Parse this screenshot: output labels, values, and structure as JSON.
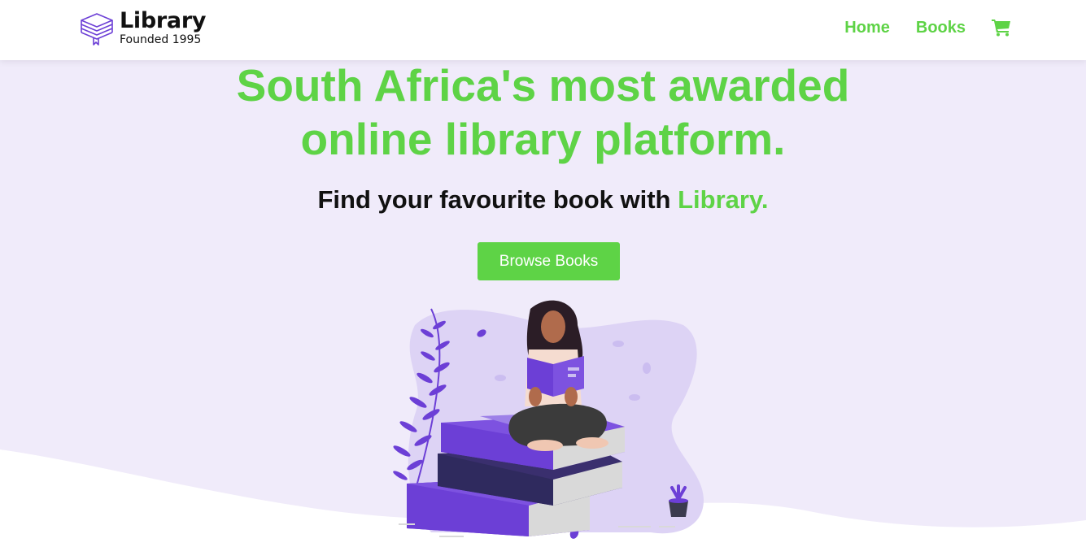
{
  "brand": {
    "name": "Library",
    "tagline": "Founded 1995",
    "accent_color": "#5ed346",
    "logo_icon": "stacked-books-icon",
    "logo_color": "#6c3fd6"
  },
  "nav": {
    "links": [
      {
        "label": "Home"
      },
      {
        "label": "Books"
      }
    ],
    "cart_icon": "shopping-cart-icon"
  },
  "hero": {
    "title_line1": "South Africa's most awarded",
    "title_line2": "online library platform.",
    "subtitle_prefix": "Find your favourite book with",
    "subtitle_accent": "Library.",
    "cta_label": "Browse Books",
    "illustration": "woman-reading-on-books-illustration",
    "background_color": "#f0ebfa"
  }
}
